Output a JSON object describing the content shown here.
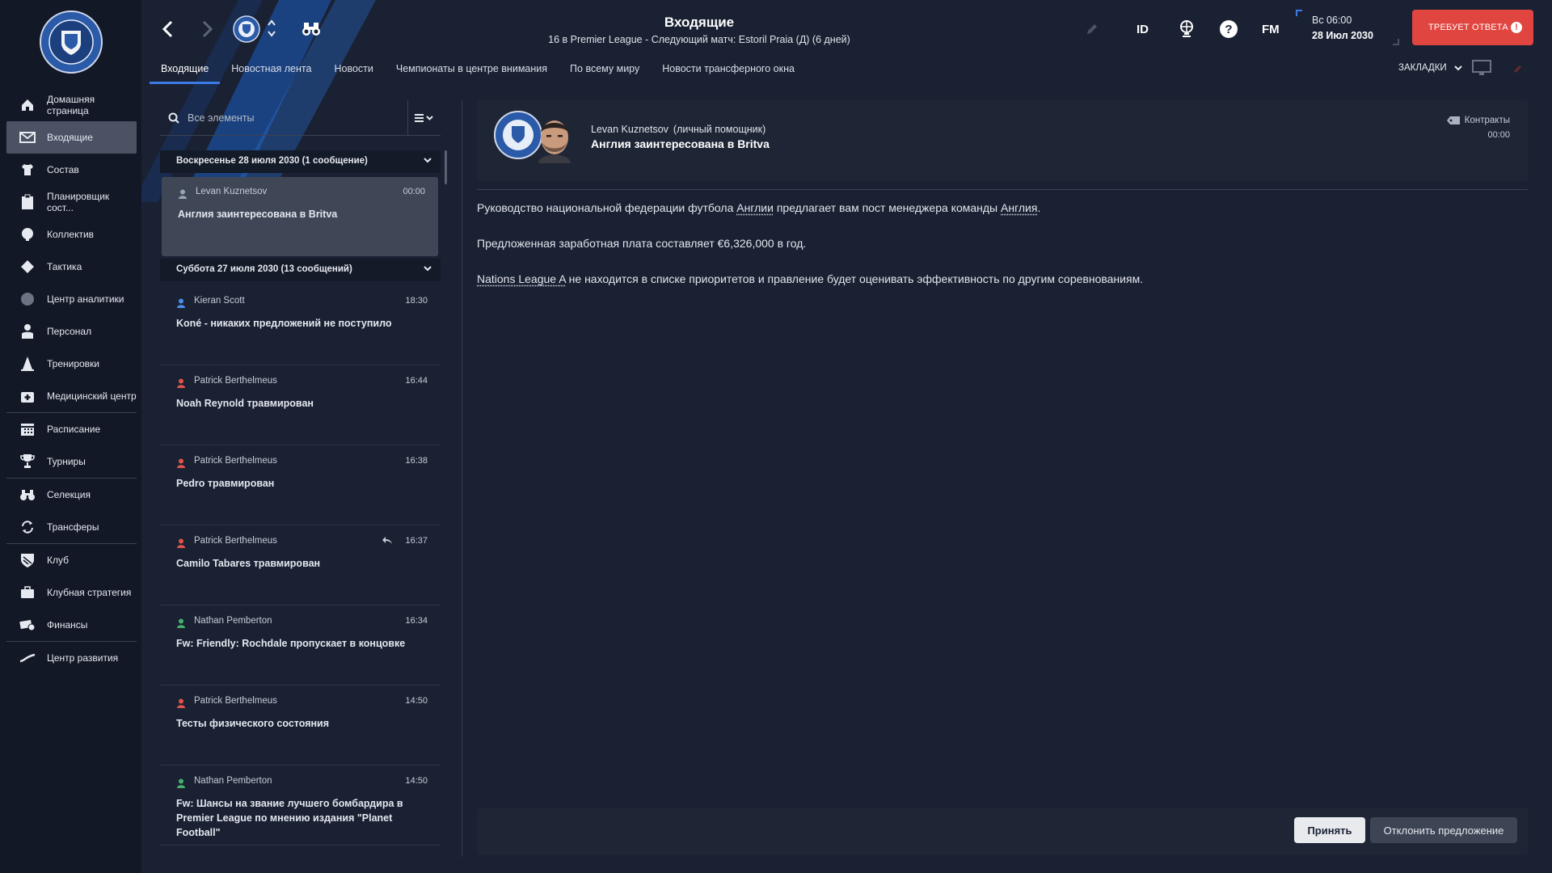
{
  "header": {
    "title": "Входящие",
    "subtitle": "16 в Premier League - Следующий матч: Estoril Praia (Д) (6 дней)",
    "date_day": "Вс 06:00",
    "date_full": "28 Июл 2030",
    "requires_response": "ТРЕБУЕТ ОТВЕТА",
    "requires_icon": "!",
    "id_label": "ID",
    "fm_label": "FM",
    "bookmarks": "ЗАКЛАДКИ"
  },
  "tabs": [
    {
      "label": "Входящие",
      "active": true
    },
    {
      "label": "Новостная лента"
    },
    {
      "label": "Новости"
    },
    {
      "label": "Чемпионаты в центре внимания"
    },
    {
      "label": "По всему миру"
    },
    {
      "label": "Новости трансферного окна"
    }
  ],
  "sidebar": {
    "club_logo": "Rochdale AFC crest",
    "items": [
      {
        "label": "Домашняя страница",
        "icon": "home-icon"
      },
      {
        "label": "Входящие",
        "icon": "inbox-icon",
        "active": true
      },
      {
        "label": "Состав",
        "icon": "shirt-icon"
      },
      {
        "label": "Планировщик сост...",
        "icon": "clipboard-icon"
      },
      {
        "label": "Коллектив",
        "icon": "team-icon"
      },
      {
        "label": "Тактика",
        "icon": "tactics-icon"
      },
      {
        "label": "Центр аналитики",
        "icon": "analytics-icon"
      },
      {
        "label": "Персонал",
        "icon": "staff-icon"
      },
      {
        "label": "Тренировки",
        "icon": "cone-icon"
      },
      {
        "label": "Медицинский центр",
        "icon": "medical-icon"
      },
      {
        "label": "Расписание",
        "icon": "calendar-icon"
      },
      {
        "label": "Турниры",
        "icon": "trophy-icon"
      },
      {
        "label": "Селекция",
        "icon": "binoculars-icon"
      },
      {
        "label": "Трансферы",
        "icon": "transfer-icon"
      },
      {
        "label": "Клуб",
        "icon": "shield-icon"
      },
      {
        "label": "Клубная стратегия",
        "icon": "briefcase-icon"
      },
      {
        "label": "Финансы",
        "icon": "money-icon"
      },
      {
        "label": "Центр развития",
        "icon": "growth-icon"
      }
    ]
  },
  "search": {
    "placeholder": "Все элементы"
  },
  "inbox": {
    "groups": [
      {
        "label": "Воскресенье 28 июля 2030 (1 сообщение)"
      },
      {
        "label": "Суббота 27 июля 2030 (13 сообщений)"
      }
    ],
    "messages": [
      {
        "sender": "Levan Kuznetsov",
        "time": "00:00",
        "subject": "Англия заинтересована в Britva",
        "icon_color": "#9aa3b2"
      },
      {
        "sender": "Kieran Scott",
        "time": "18:30",
        "subject": "Koné - никаких предложений не поступило",
        "icon_color": "#4a8ee8"
      },
      {
        "sender": "Patrick Berthelmeus",
        "time": "16:44",
        "subject": "Noah Reynold травмирован",
        "icon_color": "#e0524b"
      },
      {
        "sender": "Patrick Berthelmeus",
        "time": "16:38",
        "subject": "Pedro травмирован",
        "icon_color": "#e0524b"
      },
      {
        "sender": "Patrick Berthelmeus",
        "time": "16:37",
        "subject": "Camilo Tabares травмирован",
        "icon_color": "#e0524b"
      },
      {
        "sender": "Nathan Pemberton",
        "time": "16:34",
        "subject": "Fw: Friendly: Rochdale пропускает в концовке",
        "icon_color": "#46b06a"
      },
      {
        "sender": "Patrick Berthelmeus",
        "time": "14:50",
        "subject": "Тесты физического состояния",
        "icon_color": "#e0524b"
      },
      {
        "sender": "Nathan Pemberton",
        "time": "14:50",
        "subject": "Fw: Шансы на звание лучшего бомбардира в Premier League по мнению издания \"Planet Football\"",
        "icon_color": "#46b06a"
      }
    ]
  },
  "message": {
    "from": "Levan Kuznetsov",
    "role": "(личный помощник)",
    "title": "Англия заинтересована в Britva",
    "tag": "Контракты",
    "tag_time": "00:00",
    "body": {
      "p1_a": "Руководство национальной федерации футбола ",
      "p1_link1": "Англии",
      "p1_b": " предлагает вам пост менеджера команды ",
      "p1_link2": "Англия",
      "p1_c": ".",
      "p2": "Предложенная заработная плата составляет €6,326,000 в год.",
      "p3_link": "Nations League A",
      "p3_rest": " не находится в списке приоритетов и правление будет оценивать эффективность по другим соревнованиям."
    }
  },
  "actions": {
    "accept": "Принять",
    "decline": "Отклонить предложение"
  }
}
